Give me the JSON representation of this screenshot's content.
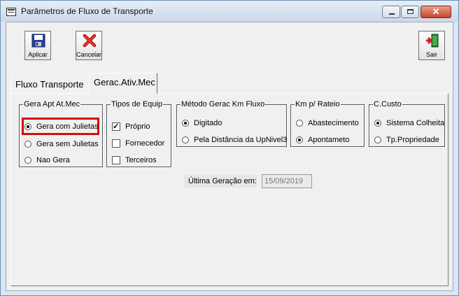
{
  "window": {
    "title": "Parâmetros de Fluxo de Transporte",
    "minimize_label": "",
    "maximize_label": "",
    "close_label": "✕"
  },
  "toolbar": {
    "apply_label": "Aplicar",
    "cancel_label": "Cancelar",
    "exit_label": "Sair"
  },
  "tabs": [
    {
      "label": "Fluxo Transporte",
      "active": false
    },
    {
      "label": "Gerac.Ativ.Mec",
      "active": true
    }
  ],
  "groups": {
    "gera_apt": {
      "legend": "Gera Apt At.Mec",
      "options": [
        {
          "label": "Gera com Julietas",
          "selected": true
        },
        {
          "label": "Gera sem Julietas",
          "selected": false
        },
        {
          "label": "Nao Gera",
          "selected": false
        }
      ]
    },
    "tipos_equip": {
      "legend": "Tipos de Equip",
      "options": [
        {
          "label": "Próprio",
          "checked": true
        },
        {
          "label": "Fornecedor",
          "checked": false
        },
        {
          "label": "Terceiros",
          "checked": false
        }
      ]
    },
    "metodo": {
      "legend": "Método Gerac Km Fluxo",
      "options": [
        {
          "label": "Digitado",
          "selected": true
        },
        {
          "label": "Pela Distância da UpNivel3",
          "selected": false
        }
      ]
    },
    "km_rateio": {
      "legend": "Km p/ Rateio",
      "options": [
        {
          "label": "Abastecimento",
          "selected": false
        },
        {
          "label": "Apontameto",
          "selected": true
        }
      ]
    },
    "ccusto": {
      "legend": "C.Custo",
      "options": [
        {
          "label": "Sistema Colheita",
          "selected": true
        },
        {
          "label": "Tp.Propriedade",
          "selected": false
        }
      ]
    }
  },
  "last_generation": {
    "label": "Última Geração em:",
    "value": "15/09/2019"
  },
  "colors": {
    "highlight": "#d01010",
    "close_button": "#c84426"
  },
  "icons": [
    "window-app-icon",
    "save-disk-icon",
    "cancel-x-icon",
    "exit-door-icon"
  ]
}
